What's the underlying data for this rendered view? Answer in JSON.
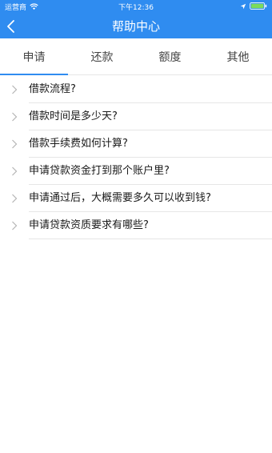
{
  "status_bar": {
    "carrier": "运营商",
    "time": "下午12:36",
    "wifi_icon": "wifi-icon",
    "location_icon": "location-arrow-icon",
    "battery_icon": "battery-icon"
  },
  "header": {
    "title": "帮助中心",
    "back_icon": "chevron-left-icon",
    "background": "#2f8cf0"
  },
  "tabs": [
    {
      "label": "申请",
      "active": true
    },
    {
      "label": "还款",
      "active": false
    },
    {
      "label": "额度",
      "active": false
    },
    {
      "label": "其他",
      "active": false
    }
  ],
  "faq": {
    "chevron_icon": "chevron-right-icon",
    "items": [
      {
        "label": "借款流程?"
      },
      {
        "label": "借款时间是多少天?"
      },
      {
        "label": "借款手续费如何计算?"
      },
      {
        "label": "申请贷款资金打到那个账户里?"
      },
      {
        "label": "申请通过后，大概需要多久可以收到钱?"
      },
      {
        "label": "申请贷款资质要求有哪些?"
      }
    ]
  }
}
